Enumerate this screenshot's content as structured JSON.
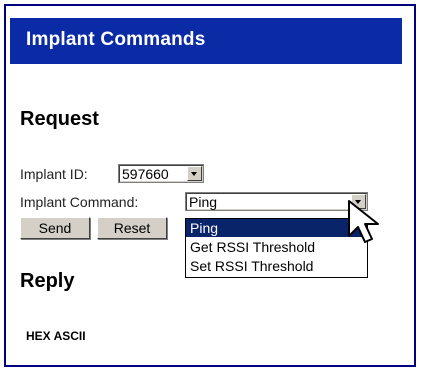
{
  "header": {
    "title": "Implant Commands"
  },
  "request": {
    "heading": "Request",
    "implant_id_label": "Implant ID:",
    "implant_id_value": "597660",
    "command_label": "Implant Command:",
    "command_value": "Ping",
    "send_label": "Send",
    "reset_label": "Reset"
  },
  "dropdown": {
    "options": [
      "Ping",
      "Get RSSI Threshold",
      "Set RSSI Threshold"
    ],
    "selected_index": 0
  },
  "reply": {
    "heading": "Reply",
    "columns_label": "HEX ASCII"
  },
  "colors": {
    "title_bar": "#0a2aa6",
    "frame_border": "#000080",
    "selection": "#0a246a"
  }
}
